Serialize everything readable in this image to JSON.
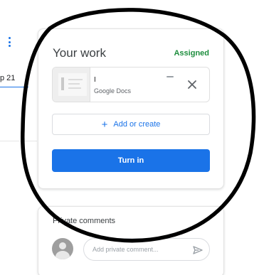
{
  "left_panel": {
    "date_fragment": "p 21"
  },
  "work_card": {
    "title": "Your work",
    "status": "Assigned",
    "status_color": "#1e8e3e",
    "attachment": {
      "name": "I",
      "type": "Google Docs",
      "thumbnail_icon": "document-thumbnail-icon",
      "remove_icon": "close-icon"
    },
    "add_button_label": "Add or create",
    "add_icon": "plus-icon",
    "turn_in_label": "Turn in",
    "accent_color": "#1a73e8"
  },
  "comments_card": {
    "title": "Private comments",
    "input_placeholder": "Add private comment...",
    "input_value": "",
    "avatar_icon": "user-avatar-icon",
    "send_icon": "send-icon"
  },
  "annotation": {
    "shape": "hand-drawn-circle",
    "color": "#000000"
  }
}
